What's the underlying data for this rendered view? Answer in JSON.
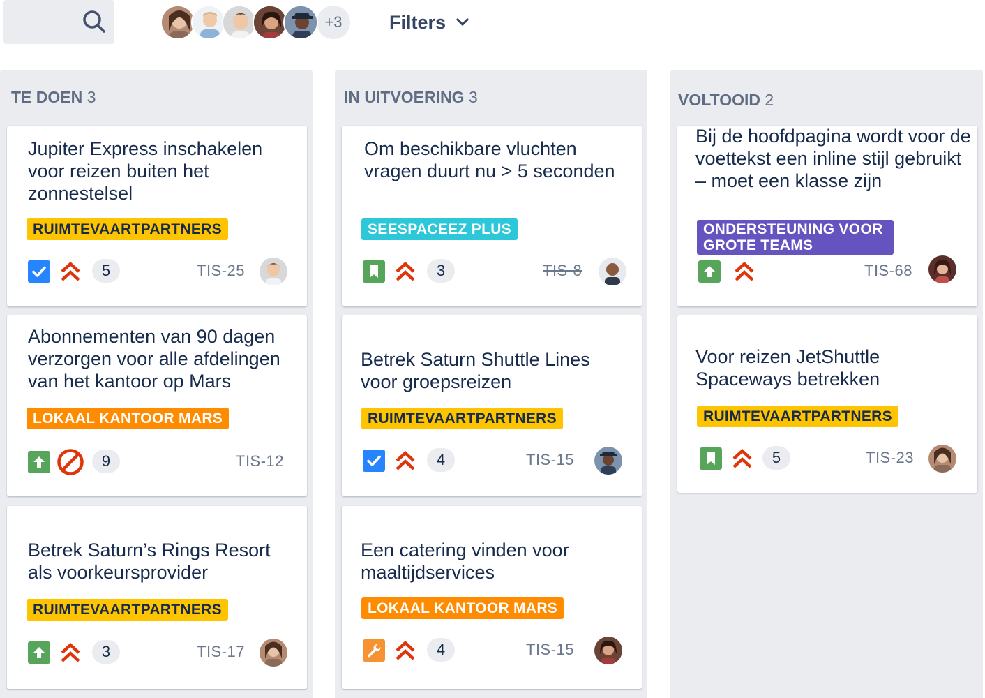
{
  "toolbar": {
    "more_count": "+3",
    "filters_label": "Filters"
  },
  "columns": [
    {
      "name": "TE DOEN",
      "count": "3",
      "cards": [
        {
          "title": "Jupiter Express inschakelen voor reizen buiten het zonnestelsel",
          "label": "RUIMTEVAARTPARTNERS",
          "type_icon": "task-checkbox-icon",
          "priority_icon": "highest-priority-icon",
          "count": "5",
          "key": "TIS-25"
        },
        {
          "title": "Abonnementen van 90 dagen verzorgen voor alle afdelingen van het kantoor op Mars",
          "label": "LOKAAL KANTOOR MARS",
          "type_icon": "improvement-arrow-icon",
          "priority_icon": "blocked-icon",
          "count": "9",
          "key": "TIS-12"
        },
        {
          "title": "Betrek Saturn’s Rings Resort als voorkeursprovider",
          "label": "RUIMTEVAARTPARTNERS",
          "type_icon": "improvement-arrow-icon",
          "priority_icon": "highest-priority-icon",
          "count": "3",
          "key": "TIS-17"
        }
      ]
    },
    {
      "name": "IN UITVOERING",
      "count": "3",
      "cards": [
        {
          "title": "Om beschikbare vluchten vragen duurt nu > 5 seconden",
          "label": "SEESPACEEZ PLUS",
          "type_icon": "story-bookmark-icon",
          "priority_icon": "highest-priority-icon",
          "count": "3",
          "key": "TIS-8"
        },
        {
          "title": "Betrek Saturn Shuttle Lines voor groepsreizen",
          "label": "RUIMTEVAARTPARTNERS",
          "type_icon": "task-checkbox-icon",
          "priority_icon": "highest-priority-icon",
          "count": "4",
          "key": "TIS-15"
        },
        {
          "title": "Een catering vinden voor maaltijdservices",
          "label": "LOKAAL KANTOOR MARS",
          "type_icon": "wrench-icon",
          "priority_icon": "highest-priority-icon",
          "count": "4",
          "key": "TIS-15"
        }
      ]
    },
    {
      "name": "VOLTOOID",
      "count": "2",
      "cards": [
        {
          "title": "Bij de hoofdpagina wordt voor de voettekst een inline stijl gebruikt – moet een klasse zijn",
          "label": "ONDERSTEUNING VOOR GROTE TEAMS",
          "type_icon": "improvement-arrow-icon",
          "priority_icon": "highest-priority-icon",
          "key": "TIS-68"
        },
        {
          "title": "Voor reizen JetShuttle Spaceways betrekken",
          "label": "RUIMTEVAARTPARTNERS",
          "type_icon": "story-bookmark-icon",
          "priority_icon": "highest-priority-icon",
          "count": "5",
          "key": "TIS-23"
        }
      ]
    }
  ],
  "colors": {
    "column_bg": "#ebecf0",
    "label_yellow": "#ffc400",
    "label_orange": "#ff8b00",
    "label_teal": "#2dc7da",
    "label_purple": "#6554c0",
    "task_blue": "#2684ff",
    "improvement_green": "#57a55a",
    "priority_red": "#de350b"
  }
}
